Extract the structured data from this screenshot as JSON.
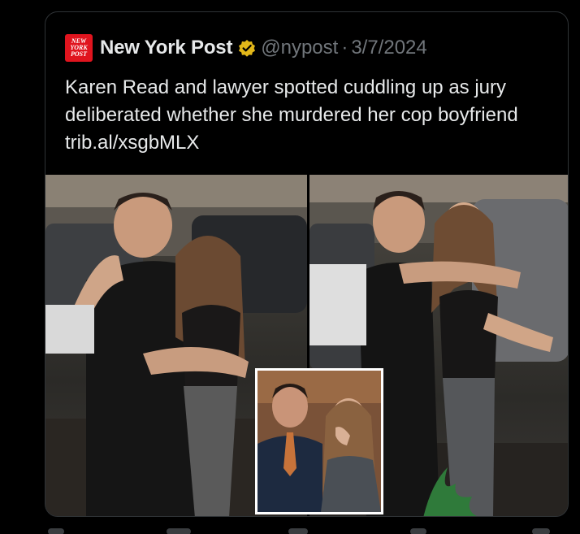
{
  "tweet": {
    "author_name": "New York Post",
    "handle": "@nypost",
    "separator": "·",
    "date": "3/7/2024",
    "logo_text": [
      "NEW",
      "YORK",
      "POST"
    ],
    "text": "Karen Read and lawyer spotted cuddling up as jury deliberated whether she murdered her cop boyfriend trib.al/xsgbMLX"
  },
  "colors": {
    "background": "#000000",
    "text_primary": "#e7e9ea",
    "text_secondary": "#71767b",
    "logo_red": "#e0141e",
    "verified_gold": "#e2b719"
  },
  "icons": {
    "verified": "verified-badge-icon"
  }
}
